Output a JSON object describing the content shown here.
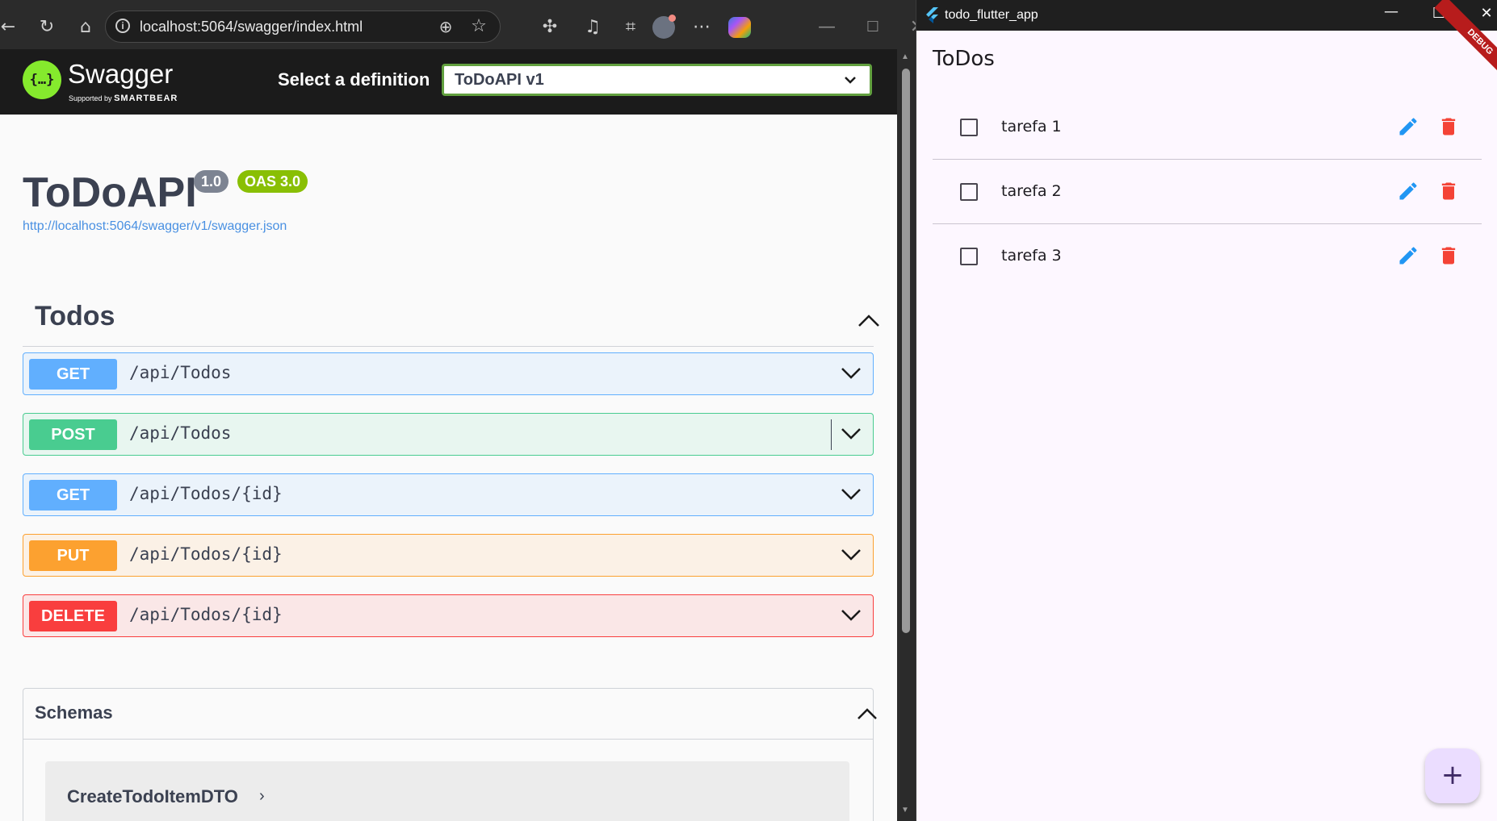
{
  "browser": {
    "url": "localhost:5064/swagger/index.html"
  },
  "swagger": {
    "brand": "Swagger",
    "supported_by": "Supported by",
    "smartbear": "SMARTBEAR",
    "select_label": "Select a definition",
    "selected_definition": "ToDoAPI v1",
    "api_title": "ToDoAPI",
    "version_badge": "1.0",
    "oas_badge": "OAS 3.0",
    "spec_url": "http://localhost:5064/swagger/v1/swagger.json",
    "tag": "Todos",
    "operations": [
      {
        "method": "GET",
        "path": "/api/Todos",
        "color": "#61affe",
        "bg": "#ebf3fb"
      },
      {
        "method": "POST",
        "path": "/api/Todos",
        "color": "#49cc90",
        "bg": "#e8f6f0"
      },
      {
        "method": "GET",
        "path": "/api/Todos/{id}",
        "color": "#61affe",
        "bg": "#ebf3fb"
      },
      {
        "method": "PUT",
        "path": "/api/Todos/{id}",
        "color": "#fca130",
        "bg": "#fbf1e6"
      },
      {
        "method": "DELETE",
        "path": "/api/Todos/{id}",
        "color": "#f93e3e",
        "bg": "#fae7e7"
      }
    ],
    "schemas_title": "Schemas",
    "schema_item": "CreateTodoItemDTO"
  },
  "flutter": {
    "window_title": "todo_flutter_app",
    "app_title": "ToDos",
    "debug_label": "DEBUG",
    "todos": [
      {
        "label": "tarefa 1",
        "checked": false
      },
      {
        "label": "tarefa 2",
        "checked": false
      },
      {
        "label": "tarefa 3",
        "checked": false
      }
    ],
    "fab_label": "+"
  },
  "colors": {
    "edit": "#2196f3",
    "delete": "#f44336",
    "swagger_green": "#85ea2d"
  }
}
